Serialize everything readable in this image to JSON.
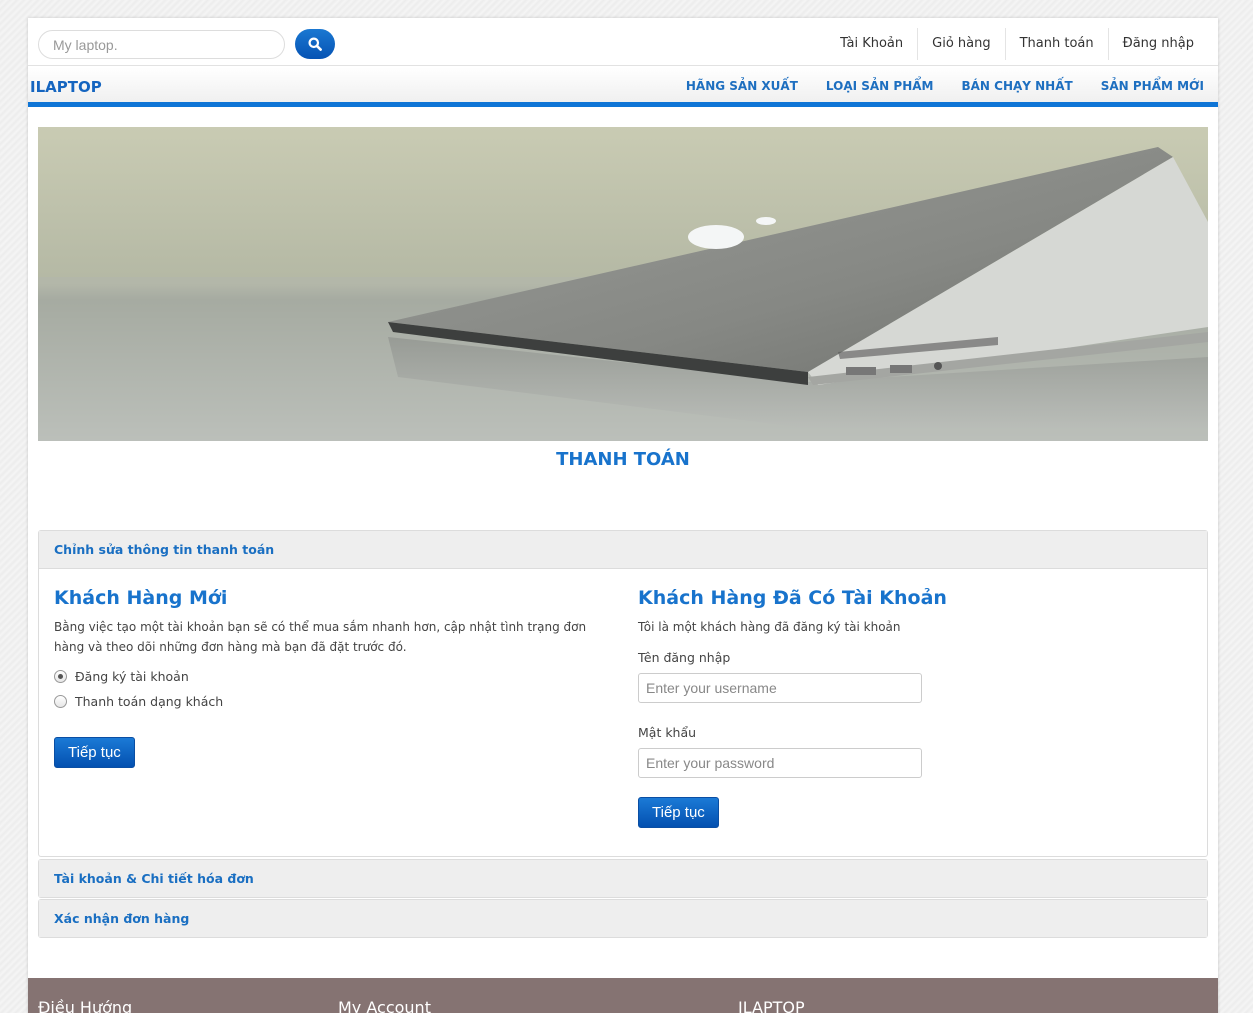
{
  "search": {
    "placeholder": "My laptop."
  },
  "top_links": [
    "Tài Khoản",
    "Giỏ hàng",
    "Thanh toán",
    "Đăng nhập"
  ],
  "brand": "ILAPTOP",
  "nav": [
    "HÃNG SẢN XUẤT",
    "LOẠI SẢN PHẨM",
    "BÁN CHẠY NHẤT",
    "SẢN PHẨM MỚI"
  ],
  "page_title": "THANH TOÁN",
  "accordion": {
    "step1": "Chỉnh sửa thông tin thanh toán",
    "step2": "Tài khoản & Chi tiết hóa đơn",
    "step3": "Xác nhận đơn hàng"
  },
  "new_customer": {
    "title": "Khách Hàng Mới",
    "description": "Bằng việc tạo một tài khoản bạn sẽ có thể mua sắm nhanh hơn, cập nhật tình trạng đơn hàng và theo dõi những đơn hàng mà bạn đã đặt trước đó.",
    "options": [
      "Đăng ký tài khoản",
      "Thanh toán dạng khách"
    ],
    "selected_option": "Đăng ký tài khoản",
    "button": "Tiếp tục"
  },
  "returning_customer": {
    "title": "Khách Hàng Đã Có Tài Khoản",
    "description": "Tôi là một khách hàng đã đăng ký tài khoản",
    "username_label": "Tên đăng nhập",
    "username_placeholder": "Enter your username",
    "password_label": "Mật khẩu",
    "password_placeholder": "Enter your password",
    "button": "Tiếp tục"
  },
  "footer": {
    "col1": "Điều Hướng",
    "col2": "My Account",
    "col3": "ILAPTOP"
  },
  "colors": {
    "accent": "#0f75d6",
    "footer": "#857372",
    "heading": "#1873cc"
  }
}
